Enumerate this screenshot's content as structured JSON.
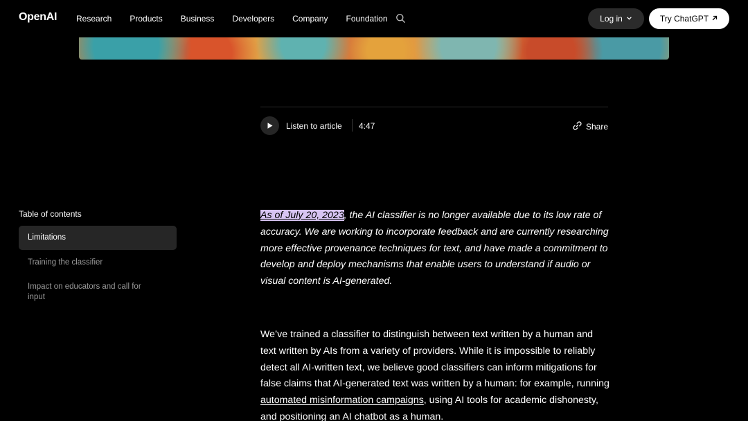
{
  "header": {
    "logo": "OpenAI",
    "nav": [
      "Research",
      "Products",
      "Business",
      "Developers",
      "Company",
      "Foundation"
    ],
    "login_label": "Log in",
    "try_label": "Try ChatGPT"
  },
  "audio": {
    "listen_label": "Listen to article",
    "duration": "4:47",
    "share_label": "Share"
  },
  "toc": {
    "title": "Table of contents",
    "items": [
      {
        "label": "Limitations"
      },
      {
        "label": "Training the classifier"
      },
      {
        "label": "Impact on educators and call for input"
      }
    ]
  },
  "article": {
    "note_highlight": "As of July 20, 2023",
    "note_rest": ", the AI classifier is no longer available due to its low rate of accuracy. We are working to incorporate feedback and are currently researching more effective provenance techniques for text, and have made a commitment to develop and deploy mechanisms that enable users to understand if audio or visual content is AI-generated.",
    "para_part1": "We’ve trained a classifier to distinguish between text written by a human and text written by AIs from a variety of providers. While it is impossible to reliably detect all AI-written text, we believe good classifiers can inform mitigations for false claims that AI-generated text was written by a human: for example, running ",
    "para_link": "automated misinformation campaigns",
    "para_part2": ", using AI tools for academic dishonesty, and positioning an AI chatbot as a human."
  },
  "colors": {
    "background": "#000000",
    "highlight": "#d7c4f2",
    "toc_active": "#262626"
  }
}
